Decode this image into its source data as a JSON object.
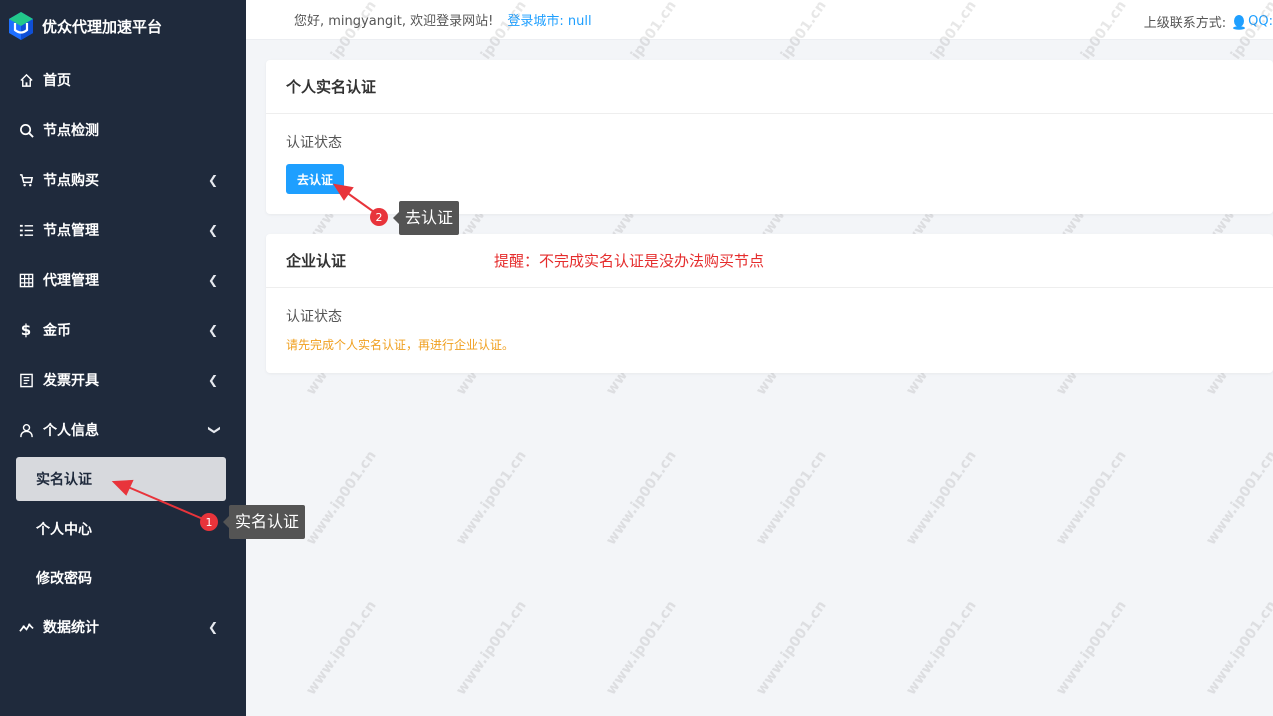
{
  "brand": {
    "title": "优众代理加速平台"
  },
  "sidebar": {
    "items": [
      {
        "icon": "home-icon",
        "label": "首页",
        "has_chevron": false
      },
      {
        "icon": "search-icon",
        "label": "节点检测",
        "has_chevron": false
      },
      {
        "icon": "cart-icon",
        "label": "节点购买",
        "has_chevron": true
      },
      {
        "icon": "list-icon",
        "label": "节点管理",
        "has_chevron": true
      },
      {
        "icon": "grid-icon",
        "label": "代理管理",
        "has_chevron": true
      },
      {
        "icon": "dollar-icon",
        "label": "金币",
        "has_chevron": true
      },
      {
        "icon": "invoice-icon",
        "label": "发票开具",
        "has_chevron": true
      },
      {
        "icon": "user-icon",
        "label": "个人信息",
        "has_chevron": true,
        "expanded": true
      }
    ],
    "sub_items": [
      {
        "label": "实名认证",
        "active": true
      },
      {
        "label": "个人中心",
        "active": false
      },
      {
        "label": "修改密码",
        "active": false
      }
    ],
    "last_item": {
      "icon": "stats-icon",
      "label": "数据统计",
      "has_chevron": true
    }
  },
  "header": {
    "greeting": "您好, mingyangit, 欢迎登录网站!",
    "city": "登录城市: null",
    "contact_label": "上级联系方式:",
    "contact_qq": "QQ:"
  },
  "personal_card": {
    "title": "个人实名认证",
    "status_label": "认证状态",
    "verify_button": "去认证"
  },
  "enterprise_card": {
    "title": "企业认证",
    "reminder": "提醒：不完成实名认证是没办法购买节点",
    "status_label": "认证状态",
    "warning": "请先完成个人实名认证，再进行企业认证。"
  },
  "annotations": [
    {
      "number": "1",
      "label": "实名认证"
    },
    {
      "number": "2",
      "label": "去认证"
    }
  ],
  "watermark": "www.ip001.cn",
  "colors": {
    "sidebar_bg": "#1f2a3c",
    "accent": "#1e9fff",
    "danger": "#e52d2d",
    "warning": "#f0a020",
    "badge": "#e8343b"
  }
}
